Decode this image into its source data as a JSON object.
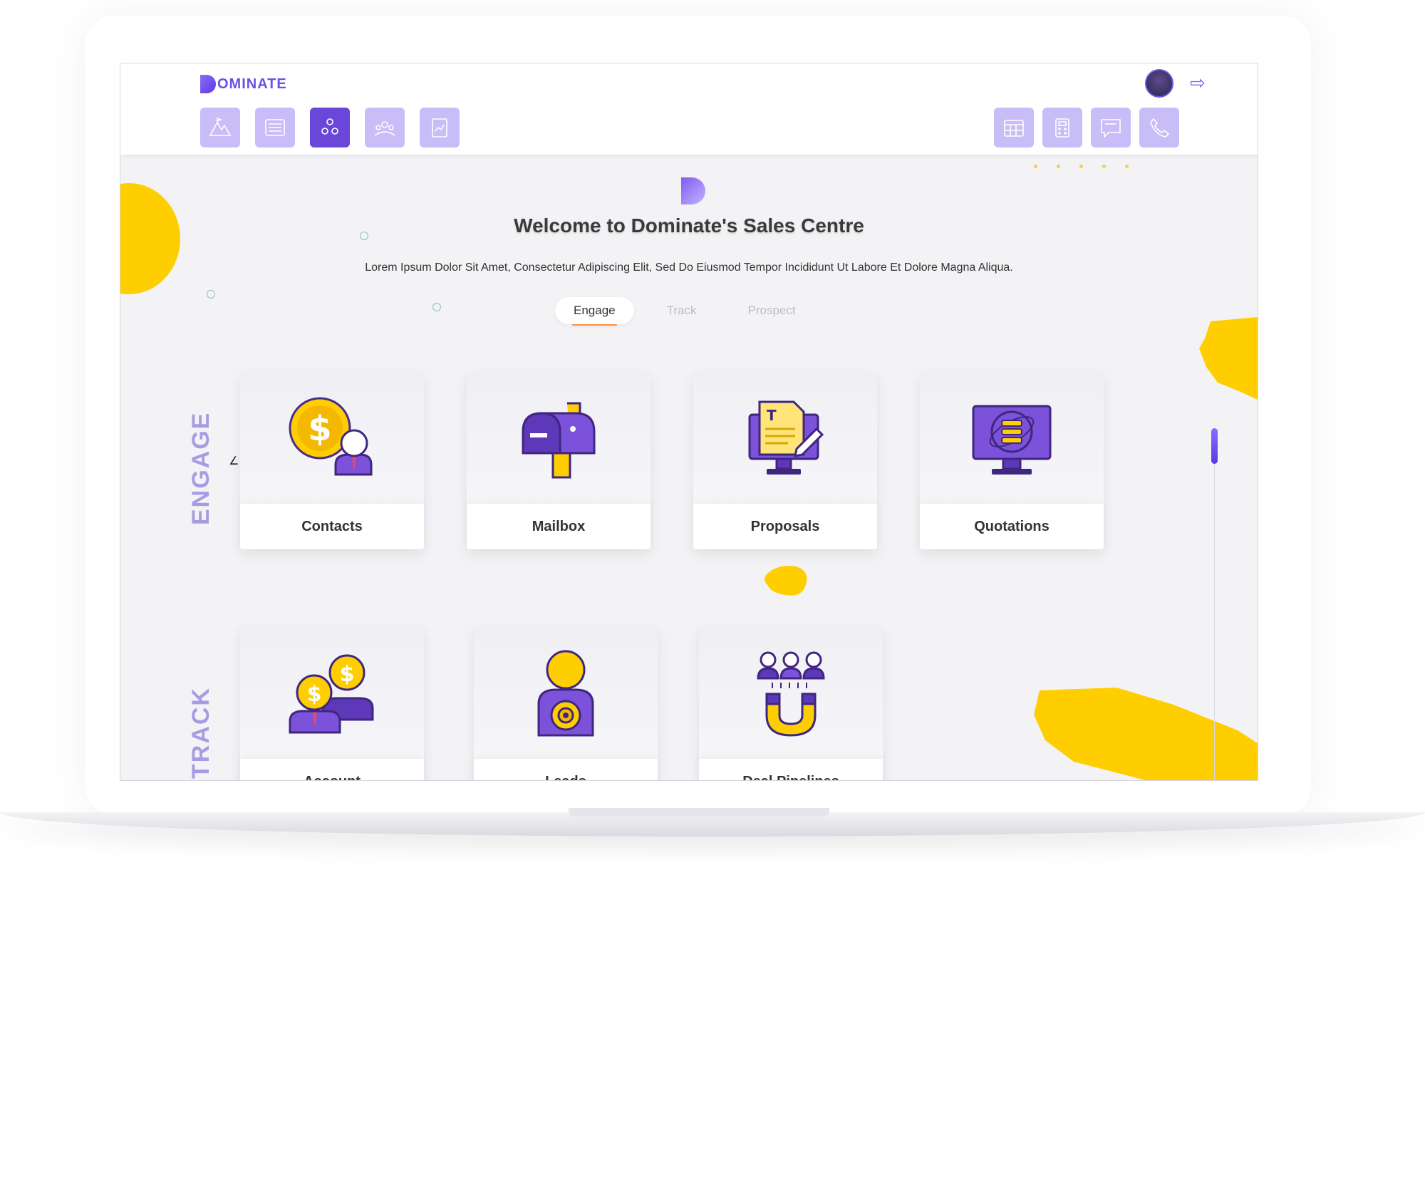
{
  "app": {
    "logo_text": "OMINATE",
    "brand_color": "#6c4fe4",
    "accent_yellow": "#ffce00"
  },
  "header": {
    "avatar_icon": "user-avatar",
    "logout_icon": "logout-icon",
    "logout_glyph": "⇨"
  },
  "toolbar": {
    "left_buttons": [
      {
        "name": "mountain-icon",
        "active": false
      },
      {
        "name": "list-icon",
        "active": false
      },
      {
        "name": "team-icon",
        "active": true
      },
      {
        "name": "group-icon",
        "active": false
      },
      {
        "name": "clipboard-chart-icon",
        "active": false
      }
    ],
    "right_buttons": [
      {
        "name": "calendar-icon"
      },
      {
        "name": "calculator-icon"
      },
      {
        "name": "chat-icon"
      },
      {
        "name": "phone-icon"
      }
    ]
  },
  "hero": {
    "title": "Welcome to Dominate's Sales Centre",
    "subtitle": "Lorem Ipsum Dolor Sit Amet, Consectetur Adipiscing Elit, Sed Do Eiusmod Tempor Incididunt Ut Labore Et Dolore Magna Aliqua."
  },
  "tabs": [
    {
      "label": "Engage",
      "active": true
    },
    {
      "label": "Track",
      "active": false
    },
    {
      "label": "Prospect",
      "active": false
    }
  ],
  "sections": {
    "engage": {
      "label": "ENGAGE",
      "cards": [
        {
          "label": "Contacts",
          "icon": "contacts-icon"
        },
        {
          "label": "Mailbox",
          "icon": "mailbox-icon"
        },
        {
          "label": "Proposals",
          "icon": "proposals-icon"
        },
        {
          "label": "Quotations",
          "icon": "quotations-icon"
        }
      ]
    },
    "track": {
      "label": "TRACK",
      "cards": [
        {
          "label": "Account",
          "icon": "account-icon"
        },
        {
          "label": "Leads",
          "icon": "leads-icon"
        },
        {
          "label": "Deal Pipelines",
          "icon": "deal-pipelines-icon"
        }
      ]
    }
  }
}
